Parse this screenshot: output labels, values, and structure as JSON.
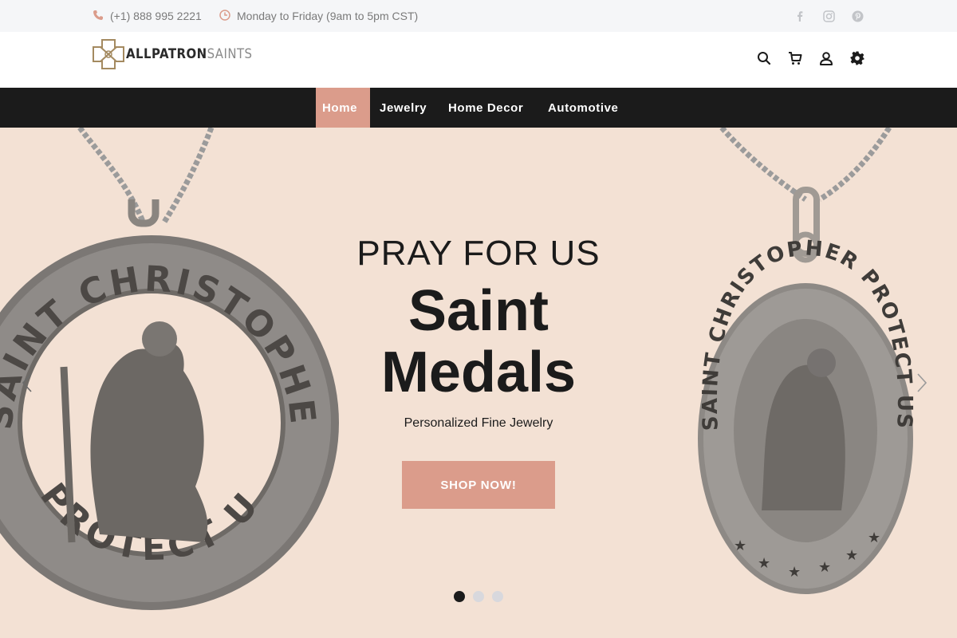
{
  "topbar": {
    "phone": "(+1) 888 995 2221",
    "hours": "Monday to Friday (9am to 5pm CST)",
    "social": [
      "facebook-icon",
      "instagram-icon",
      "pinterest-icon"
    ]
  },
  "header": {
    "logo_part1": "ALLPATRON",
    "logo_part2": "SAINTS",
    "icons": [
      "search-icon",
      "cart-icon",
      "user-icon",
      "settings-icon"
    ]
  },
  "nav": {
    "items": [
      {
        "label": "Home",
        "active": true
      },
      {
        "label": "Jewelry",
        "active": false
      },
      {
        "label": "Home Decor",
        "active": false
      },
      {
        "label": "Automotive",
        "active": false
      }
    ]
  },
  "hero": {
    "kicker": "PRAY FOR US",
    "title": "Saint Medals",
    "subtitle": "Personalized Fine Jewelry",
    "cta": "SHOP NOW!",
    "slides": 3,
    "active_slide": 1,
    "medal_left_text_top": "SAINT CHRISTOPHER",
    "medal_left_text_bottom": "PROTECT US",
    "medal_right_text": "SAINT CHRISTOPHER PROTECT US"
  },
  "colors": {
    "accent": "#db9c8b",
    "nav_bg": "#1b1b1b",
    "hero_bg": "#f3e1d4",
    "topbar_bg": "#f5f6f8"
  }
}
